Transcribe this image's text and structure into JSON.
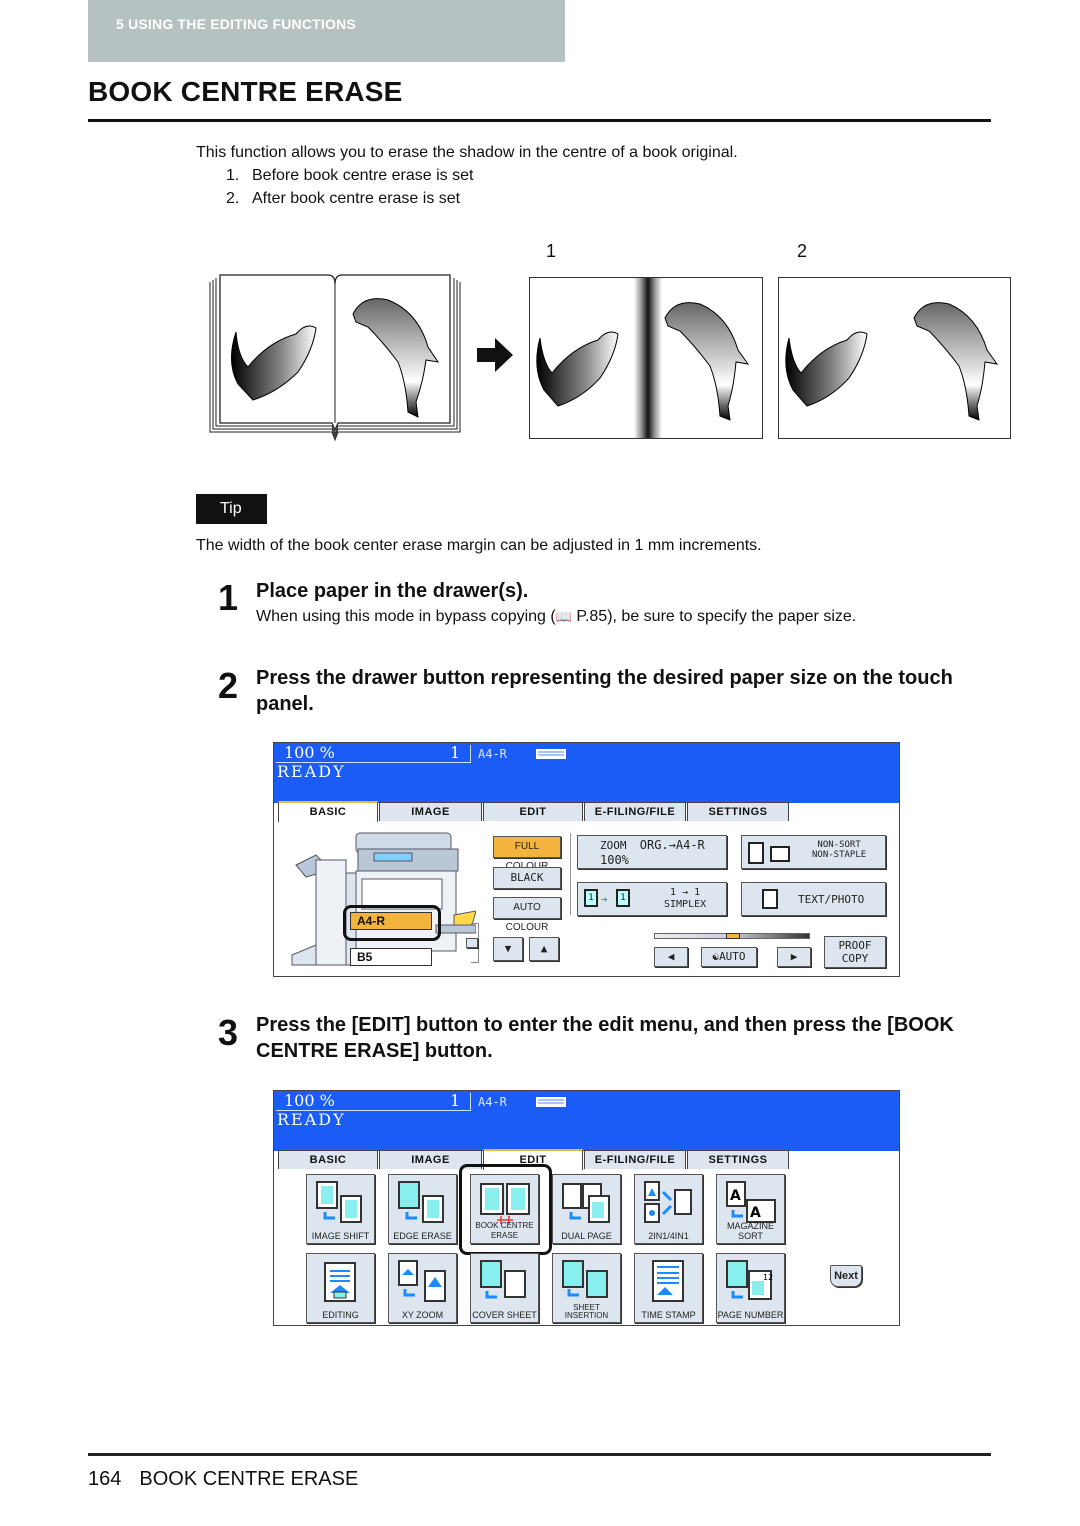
{
  "chapter": {
    "label": "5   USING THE EDITING FUNCTIONS"
  },
  "page_title": "BOOK CENTRE ERASE",
  "intro": {
    "text": "This function allows you to erase the shadow in the centre of a book original.",
    "items": [
      {
        "num": "1.",
        "text": "Before book centre erase is set"
      },
      {
        "num": "2.",
        "text": "After book centre erase is set"
      }
    ]
  },
  "figure": {
    "label_1": "1",
    "label_2": "2"
  },
  "tip": {
    "badge": "Tip",
    "text": "The width of the book center erase margin can be adjusted in 1 mm increments."
  },
  "steps": [
    {
      "num": "1",
      "heading": "Place paper in the drawer(s).",
      "body_pre": "When using this mode in bypass copying (",
      "body_ref": " P.85), be sure to specify the paper size."
    },
    {
      "num": "2",
      "heading": "Press the drawer button representing the desired paper size on the touch panel."
    },
    {
      "num": "3",
      "heading": "Press the [EDIT] button to enter the edit menu, and then press the [BOOK CENTRE ERASE] button."
    }
  ],
  "panel_basic": {
    "zoom": "100  %",
    "copies": "1",
    "paper": "A4-R",
    "status": "READY",
    "tabs": [
      "BASIC",
      "IMAGE",
      "EDIT",
      "E-FILING/FILE",
      "SETTINGS"
    ],
    "active_tab": "BASIC",
    "colour_buttons": [
      "FULL COLOUR",
      "BLACK",
      "AUTO COLOUR"
    ],
    "selected_colour": "FULL COLOUR",
    "drawers": [
      "A4-R",
      "B5"
    ],
    "selected_drawer": "A4-R",
    "zoom_btn": {
      "line1": "ZOOM",
      "line1b": "ORG.→A4-R",
      "line2": "100%"
    },
    "sort_btn": {
      "line1": "NON-SORT",
      "line2": "NON-STAPLE"
    },
    "duplex_btn": {
      "line1": "1 → 1",
      "line2": "SIMPLEX"
    },
    "mode_btn": "TEXT/PHOTO",
    "density_auto": "AUTO",
    "proof_copy": {
      "line1": "PROOF",
      "line2": "COPY"
    },
    "density_level": 0.5
  },
  "panel_edit": {
    "zoom": "100  %",
    "copies": "1",
    "paper": "A4-R",
    "status": "READY",
    "tabs": [
      "BASIC",
      "IMAGE",
      "EDIT",
      "E-FILING/FILE",
      "SETTINGS"
    ],
    "active_tab": "EDIT",
    "buttons_row1": [
      "IMAGE SHIFT",
      "EDGE ERASE",
      "BOOK CENTRE ERASE",
      "DUAL  PAGE",
      "2IN1/4IN1",
      "MAGAZINE SORT"
    ],
    "buttons_row2": [
      "EDITING",
      "XY ZOOM",
      "COVER SHEET",
      "SHEET INSERTION",
      "TIME STAMP",
      "PAGE NUMBER"
    ],
    "highlighted": "BOOK CENTRE ERASE",
    "next": "Next"
  },
  "footer": {
    "page_number": "164",
    "title": "BOOK CENTRE ERASE"
  }
}
